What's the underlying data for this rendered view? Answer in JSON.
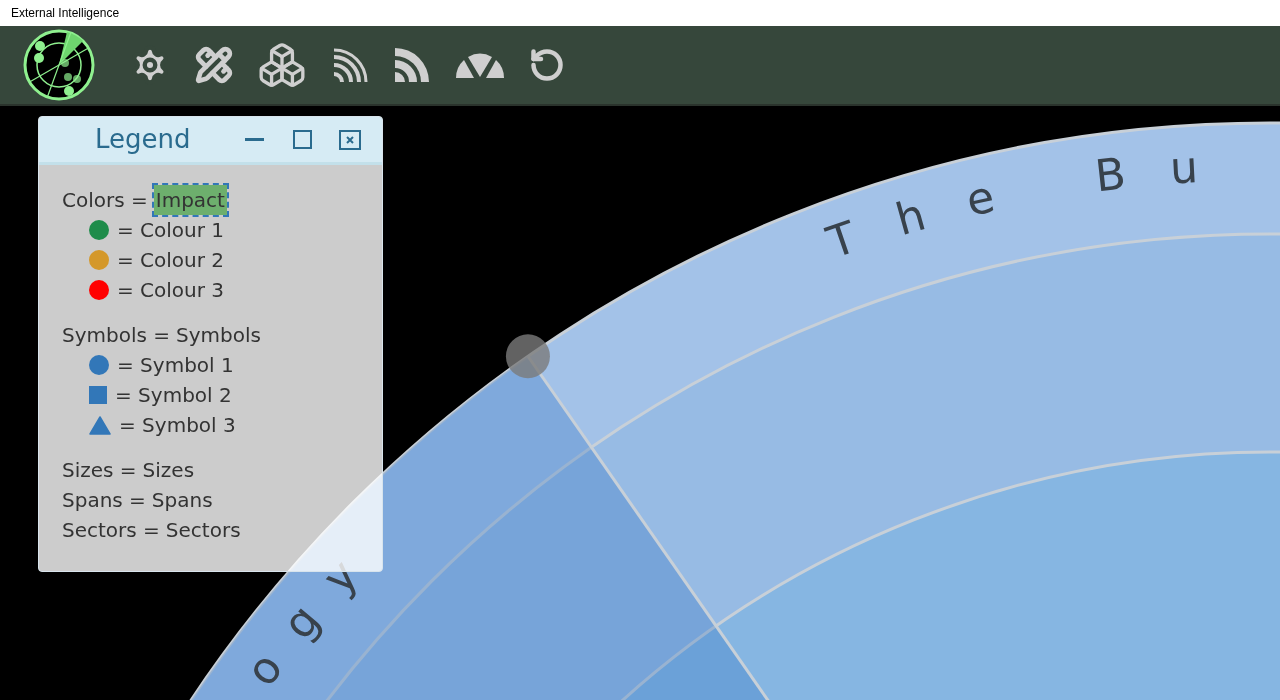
{
  "window": {
    "title": "External Intelligence"
  },
  "radar": {
    "ring_labels": [
      "ogy",
      "The Bu"
    ]
  },
  "legend": {
    "title": "Legend",
    "sections": [
      {
        "label": "Colors =",
        "value": "Impact",
        "highlighted": true,
        "items": [
          {
            "kind": "dot",
            "color": "#1e8c4a",
            "label": "= Colour 1"
          },
          {
            "kind": "dot",
            "color": "#d4982a",
            "label": "= Colour 2"
          },
          {
            "kind": "dot",
            "color": "#ff0000",
            "label": "= Colour 3"
          }
        ]
      },
      {
        "label": "Symbols =",
        "value": "Symbols",
        "highlighted": false,
        "items": [
          {
            "kind": "circle",
            "label": "= Symbol 1"
          },
          {
            "kind": "square",
            "label": "= Symbol 2"
          },
          {
            "kind": "triangle",
            "label": "= Symbol 3"
          }
        ]
      },
      {
        "label": "Sizes =",
        "value": "Sizes",
        "highlighted": false
      },
      {
        "label": "Spans =",
        "value": "Spans",
        "highlighted": false
      },
      {
        "label": "Sectors =",
        "value": "Sectors",
        "highlighted": false
      }
    ]
  }
}
